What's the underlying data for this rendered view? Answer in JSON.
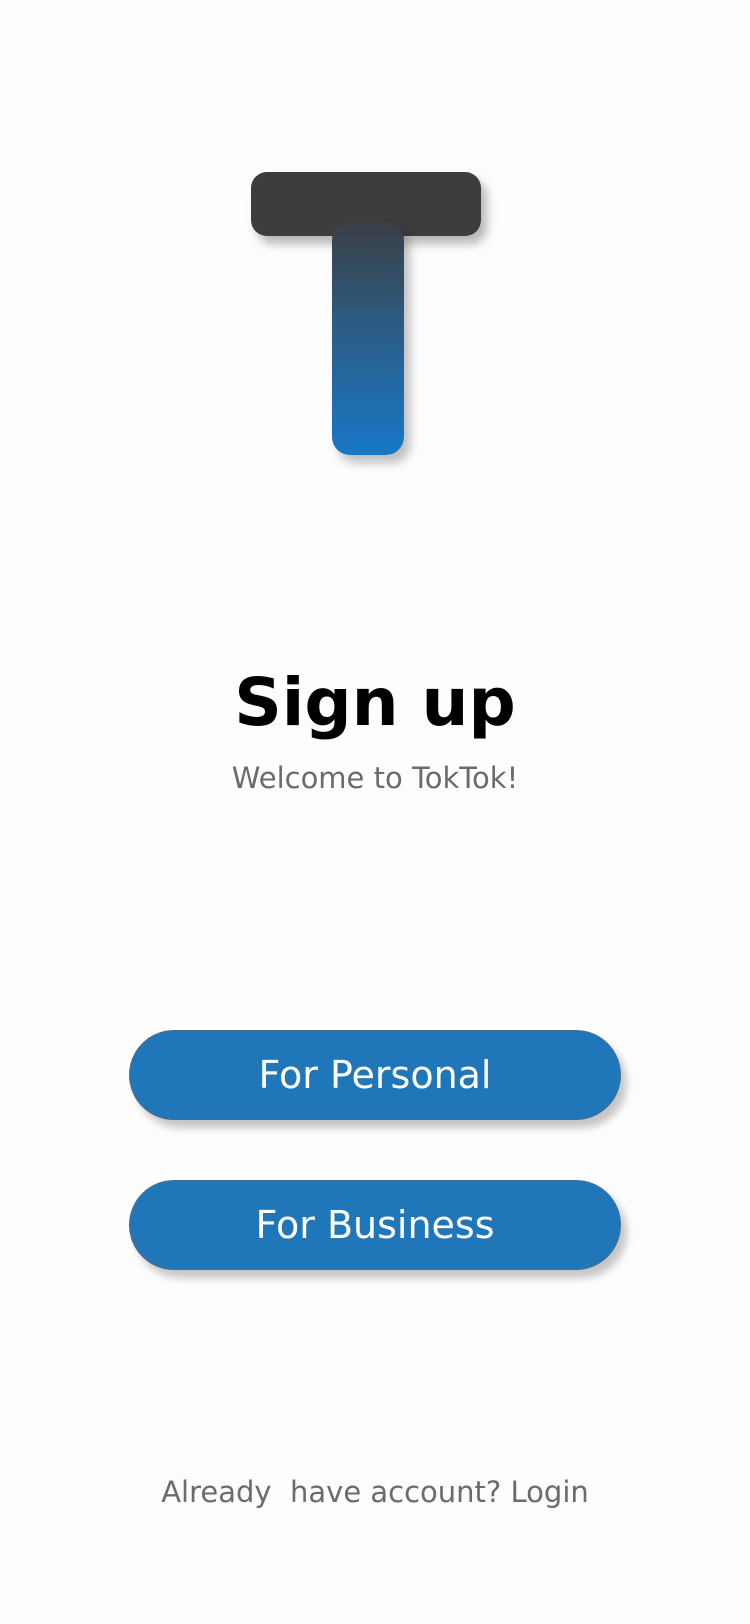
{
  "logo": {
    "icon": "t-logo-icon",
    "colors": {
      "bar": "#3d3d3d",
      "stem_top": "#3b3f45",
      "stem_bottom": "#1877c8"
    }
  },
  "header": {
    "title": "Sign up",
    "subtitle": "Welcome to TokTok!"
  },
  "actions": {
    "personal_label": "For Personal",
    "business_label": "For Business",
    "button_color": "#1f76b8"
  },
  "footer": {
    "prompt": "Already  have account?",
    "login_label": "Login"
  }
}
